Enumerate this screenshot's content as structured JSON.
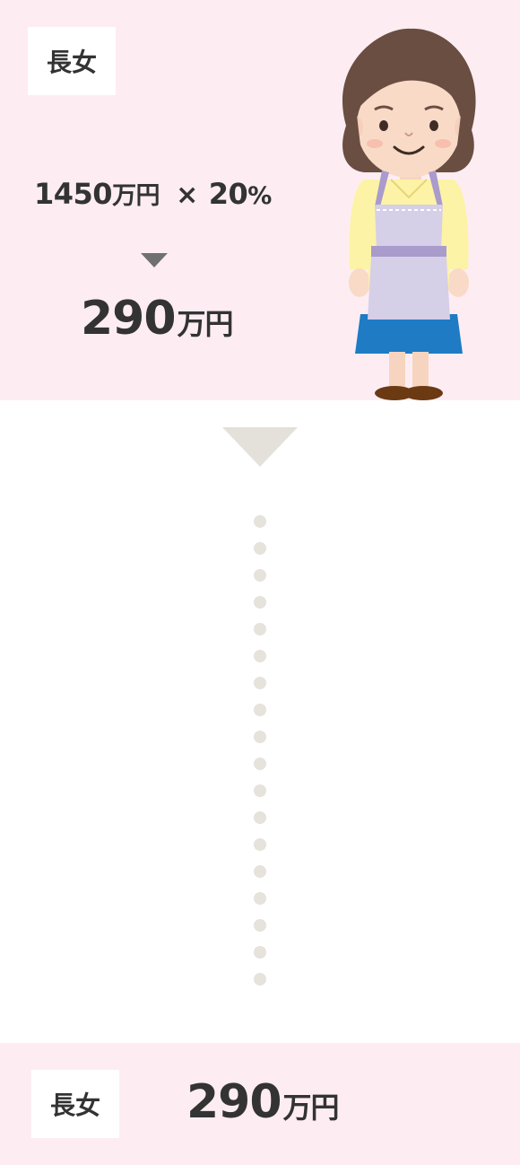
{
  "top": {
    "label": "長女",
    "formula": {
      "amount": "1450",
      "amount_unit": "万円",
      "operator": "×",
      "percent": "20",
      "percent_sign": "%"
    },
    "result_value": "290",
    "result_unit": "万円"
  },
  "bottom": {
    "label": "長女",
    "result_value": "290",
    "result_unit": "万円"
  },
  "icons": {
    "illustration": "woman-in-apron-icon",
    "down_arrow_small": "triangle-down-icon",
    "down_arrow_large": "triangle-down-icon"
  },
  "colors": {
    "panel_background": "#fdedf3",
    "text": "#333333",
    "arrow_small": "#707070",
    "connector": "#e6e2dc"
  }
}
